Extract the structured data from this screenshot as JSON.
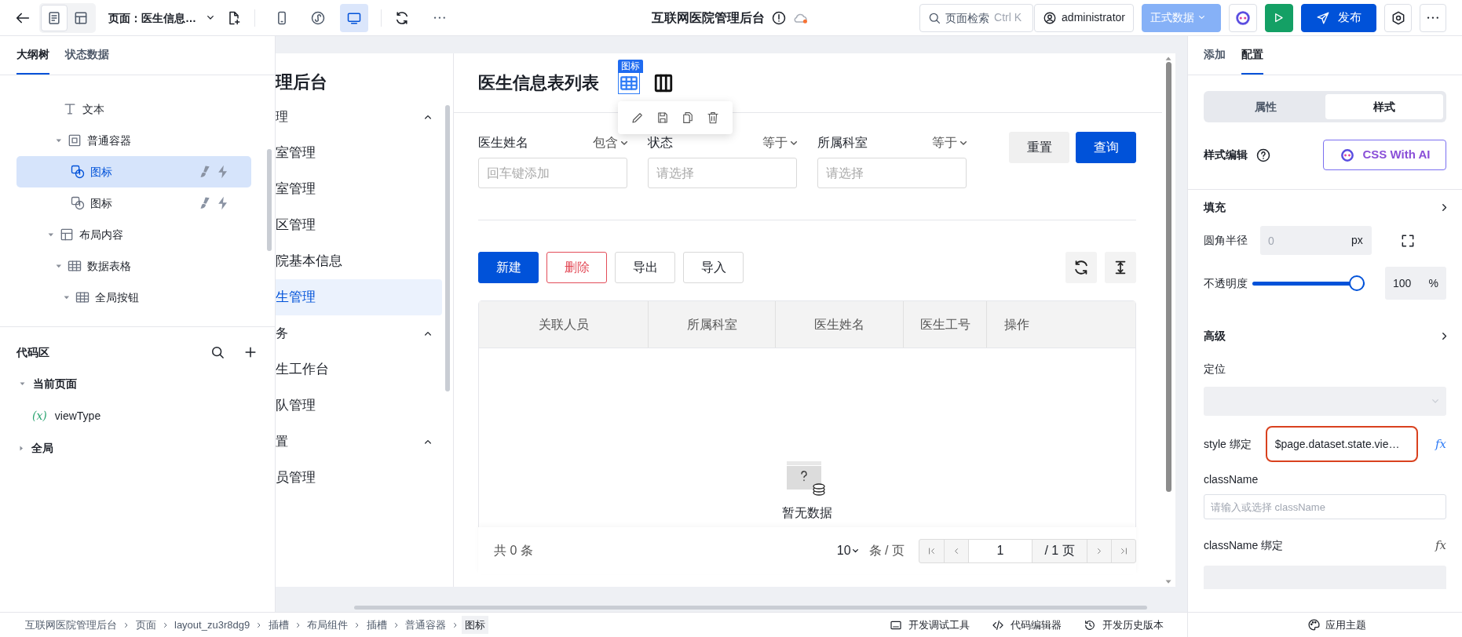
{
  "topbar": {
    "view_modes": [
      {
        "kind": "page",
        "selected": true
      },
      {
        "kind": "layout",
        "selected": false
      }
    ],
    "page_selector": "页面：医生信息…",
    "devices": [
      {
        "kind": "mobile",
        "selected": false
      },
      {
        "kind": "miniprogram",
        "selected": false
      },
      {
        "kind": "desktop",
        "selected": true
      }
    ],
    "title": "互联网医院管理后台",
    "search": {
      "placeholder": "页面检索",
      "shortcut": "Ctrl K"
    },
    "user": "administrator",
    "data_mode": {
      "label": "正式数据",
      "disabled": true
    },
    "publish": "发布"
  },
  "left_panel": {
    "tabs": [
      {
        "label": "大纲树",
        "selected": true
      },
      {
        "label": "状态数据",
        "selected": false
      }
    ],
    "outline": [
      {
        "children": [
          {
            "label": "文本",
            "kind": "text",
            "selected": false
          },
          {
            "label": "普通容器",
            "kind": "container",
            "expanded": true,
            "selected": false,
            "children": [
              {
                "label": "图标",
                "kind": "icon",
                "selected": true
              },
              {
                "label": "图标",
                "kind": "icon",
                "selected": false
              }
            ]
          }
        ]
      },
      {
        "label": "布局内容",
        "kind": "layout",
        "expanded": true,
        "selected": false,
        "children": [
          {
            "label": "数据表格",
            "kind": "table",
            "expanded": true,
            "selected": false,
            "children": [
              {
                "label": "全局按钮",
                "kind": "table",
                "expanded": true,
                "selected": false
              }
            ]
          }
        ]
      }
    ],
    "code_area": {
      "title": "代码区",
      "groups": [
        {
          "label": "当前页面",
          "expanded": true,
          "children": [
            {
              "symbol": "(x)",
              "label": "viewType"
            }
          ]
        },
        {
          "label": "全局",
          "expanded": false
        }
      ]
    }
  },
  "canvas": {
    "sidebar": {
      "title": "理后台",
      "groups": [
        {
          "label": "理",
          "expanded": true,
          "items": [
            {
              "label": "室管理",
              "selected": false
            },
            {
              "label": "室管理",
              "selected": false
            },
            {
              "label": "区管理",
              "selected": false
            },
            {
              "label": "院基本信息",
              "selected": false
            },
            {
              "label": "生管理",
              "selected": true
            }
          ]
        },
        {
          "label": "务",
          "expanded": true,
          "items": [
            {
              "label": "生工作台",
              "selected": false
            },
            {
              "label": "队管理",
              "selected": false
            }
          ]
        },
        {
          "label": "置",
          "expanded": true,
          "items": [
            {
              "label": "员管理",
              "selected": false
            }
          ]
        }
      ]
    },
    "page": {
      "title": "医生信息表列表",
      "header_icons": [
        {
          "kind": "table",
          "selected": true,
          "tag": "图标"
        },
        {
          "kind": "columns",
          "selected": false
        }
      ],
      "filters": [
        {
          "label": "医生姓名",
          "operator": "包含",
          "placeholder": "回车键添加"
        },
        {
          "label": "状态",
          "operator": "等于",
          "placeholder": "请选择"
        },
        {
          "label": "所属科室",
          "operator": "等于",
          "placeholder": "请选择"
        }
      ],
      "filter_buttons": [
        {
          "kind": "default",
          "label": "重置"
        },
        {
          "kind": "primary",
          "label": "查询"
        }
      ],
      "actions": [
        {
          "kind": "primary",
          "label": "新建"
        },
        {
          "kind": "danger",
          "label": "删除"
        },
        {
          "kind": "default",
          "label": "导出"
        },
        {
          "kind": "default",
          "label": "导入"
        }
      ],
      "table": {
        "columns": [
          "关联人员",
          "所属科室",
          "医生姓名",
          "医生工号",
          "操作"
        ],
        "empty_text": "暂无数据"
      },
      "pagination": {
        "total": "共 0 条",
        "page_size": "10",
        "per_page": "条 / 页",
        "page": "1",
        "page_count": "/ 1 页"
      }
    }
  },
  "right_panel": {
    "tabs": [
      {
        "label": "添加",
        "selected": false
      },
      {
        "label": "配置",
        "selected": true
      }
    ],
    "segments": [
      {
        "label": "属性",
        "selected": false
      },
      {
        "label": "样式",
        "selected": true
      }
    ],
    "style_editor": {
      "label": "样式编辑",
      "ai_button": "CSS With AI"
    },
    "fill": {
      "title": "填充",
      "radius": {
        "label": "圆角半径",
        "placeholder": "0",
        "unit": "px"
      },
      "opacity": {
        "label": "不透明度",
        "level": 1,
        "value": "100",
        "unit": "%"
      }
    },
    "advanced": {
      "title": "高级",
      "position": {
        "label": "定位"
      },
      "style_binding": {
        "label": "style 绑定",
        "value": "$page.dataset.state.vie…",
        "highlighted": true,
        "fx": "fx"
      },
      "class_name": {
        "label": "className",
        "placeholder": "请输入或选择 className"
      },
      "class_binding": {
        "label": "className 绑定",
        "fx": "fx"
      }
    }
  },
  "breadcrumb": [
    {
      "label": "互联网医院管理后台",
      "selected": false
    },
    {
      "label": "页面",
      "selected": false
    },
    {
      "label": "layout_zu3r8dg9",
      "selected": false
    },
    {
      "label": "插槽",
      "selected": false
    },
    {
      "label": "布局组件",
      "selected": false
    },
    {
      "label": "插槽",
      "selected": false
    },
    {
      "label": "普通容器",
      "selected": false
    },
    {
      "label": "图标",
      "selected": true
    }
  ],
  "bottom_tools": [
    {
      "kind": "debug",
      "label": "开发调试工具"
    },
    {
      "kind": "code",
      "label": "代码编辑器"
    },
    {
      "kind": "history",
      "label": "开发历史版本"
    }
  ],
  "theme": "应用主题"
}
